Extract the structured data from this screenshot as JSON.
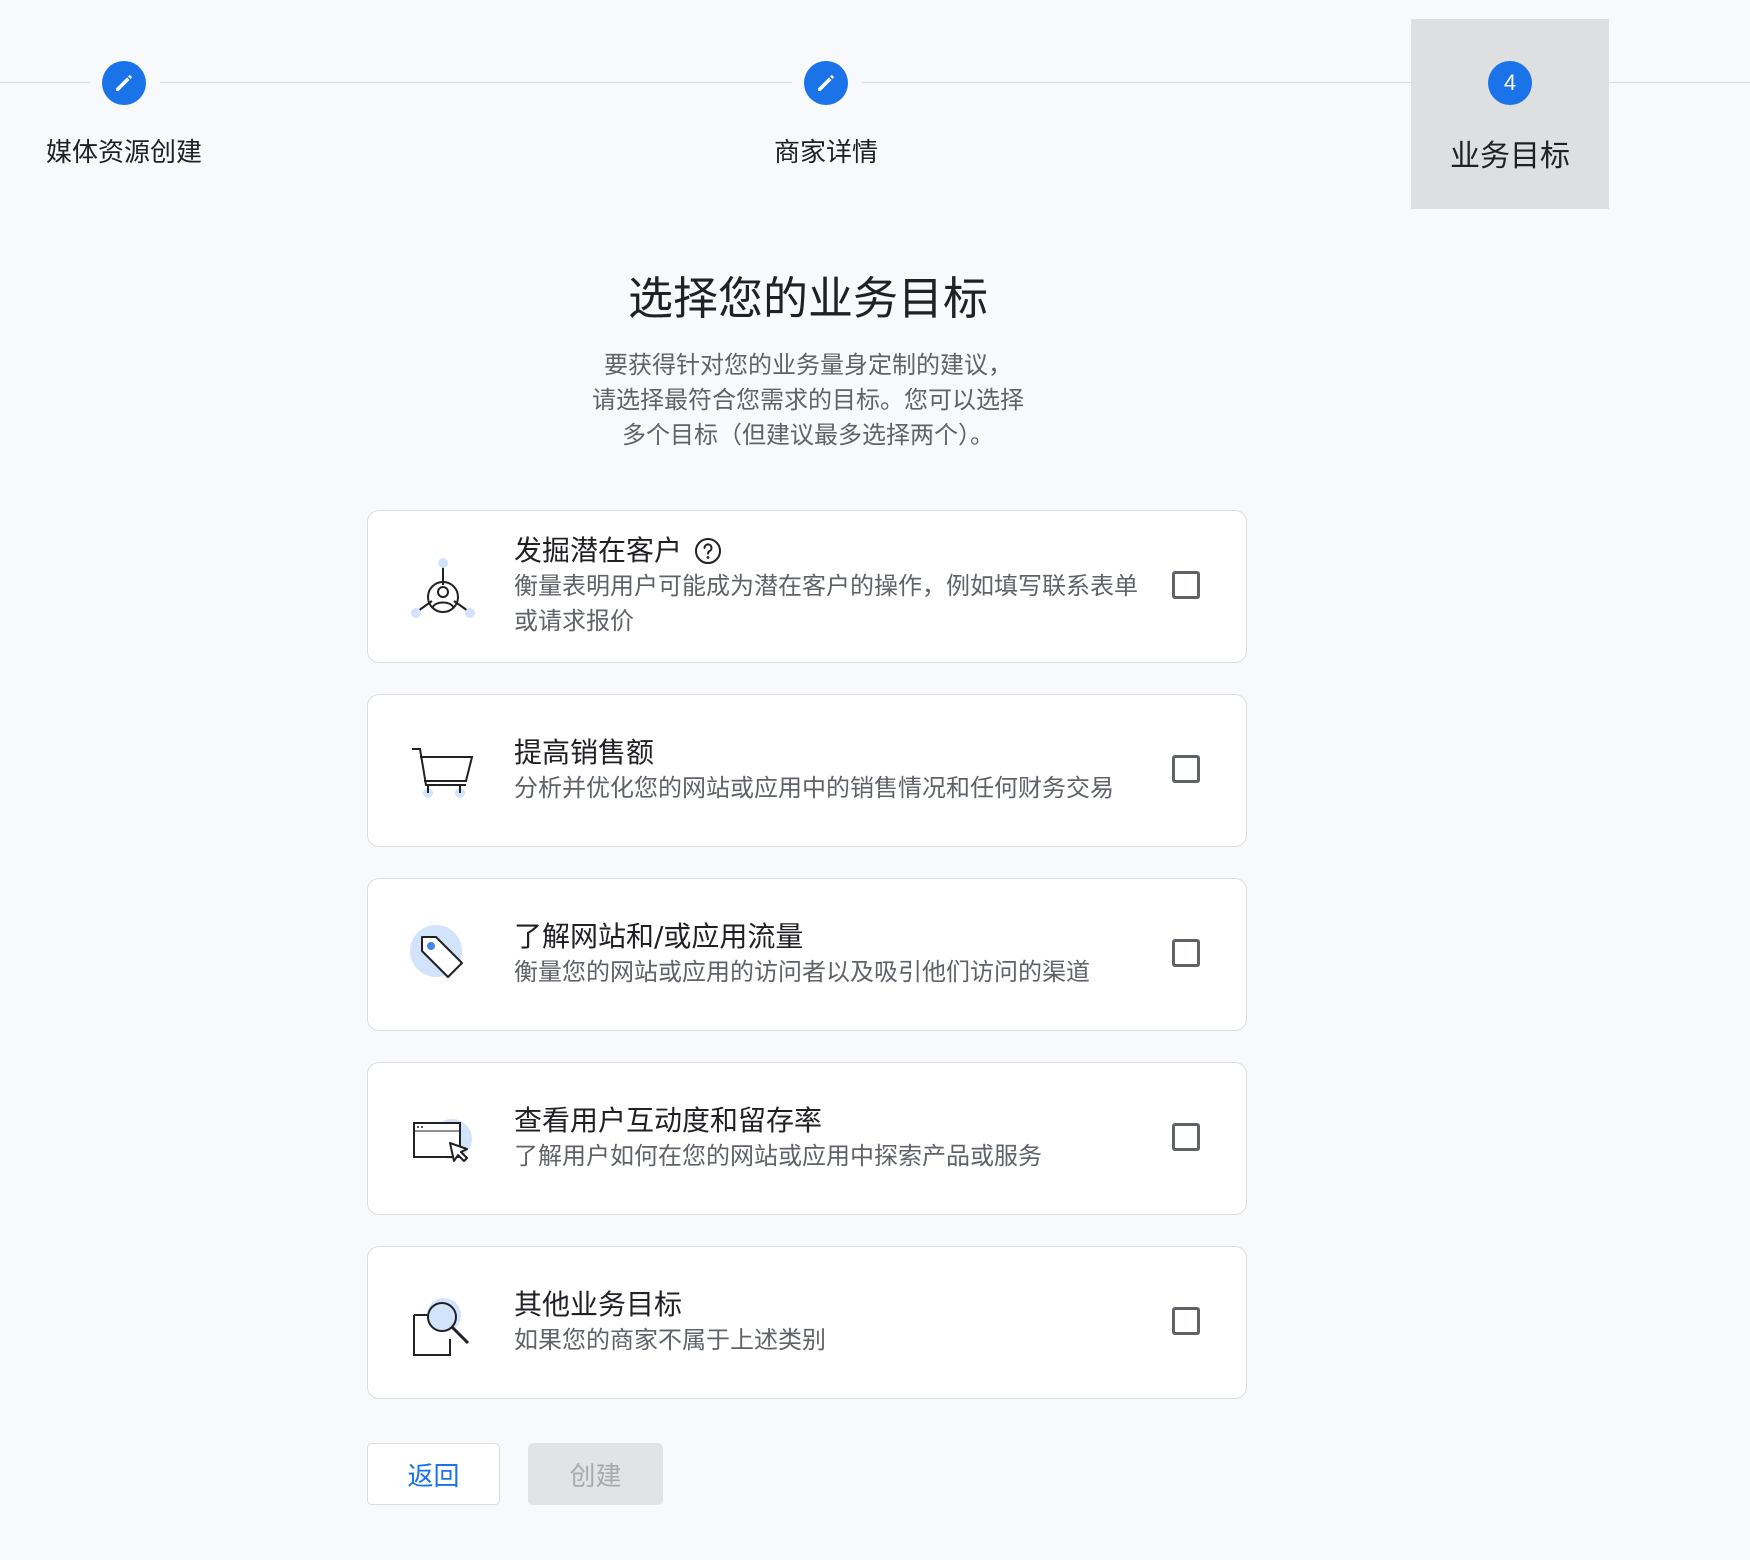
{
  "stepper": {
    "steps": [
      {
        "label": "媒体资源创建",
        "state": "done",
        "icon": "pencil-icon"
      },
      {
        "label": "商家详情",
        "state": "done",
        "icon": "pencil-icon"
      },
      {
        "label": "业务目标",
        "state": "active",
        "number": "4"
      }
    ]
  },
  "header": {
    "title": "选择您的业务目标",
    "description_lines": [
      "要获得针对您的业务量身定制的建议，",
      "请选择最符合您需求的目标。您可以选择",
      "多个目标（但建议最多选择两个）。"
    ]
  },
  "objectives": [
    {
      "title": "发掘潜在客户",
      "subtitle": "衡量表明用户可能成为潜在客户的操作，例如填写联系表单或请求报价",
      "icon": "lead-network-icon",
      "has_help": true,
      "checked": false
    },
    {
      "title": "提高销售额",
      "subtitle": "分析并优化您的网站或应用中的销售情况和任何财务交易",
      "icon": "shopping-cart-icon",
      "has_help": false,
      "checked": false
    },
    {
      "title": "了解网站和/或应用流量",
      "subtitle": "衡量您的网站或应用的访问者以及吸引他们访问的渠道",
      "icon": "tag-icon",
      "has_help": false,
      "checked": false
    },
    {
      "title": "查看用户互动度和留存率",
      "subtitle": "了解用户如何在您的网站或应用中探索产品或服务",
      "icon": "window-cursor-icon",
      "has_help": false,
      "checked": false
    },
    {
      "title": "其他业务目标",
      "subtitle": "如果您的商家不属于上述类别",
      "icon": "magnifier-document-icon",
      "has_help": false,
      "checked": false
    }
  ],
  "buttons": {
    "back_label": "返回",
    "create_label": "创建",
    "create_disabled": true
  },
  "colors": {
    "accent": "#1a73e8",
    "background": "#f8f9fa",
    "card_border": "#dadce0",
    "active_step_bg": "#dedfe1",
    "text_secondary": "#5f6368",
    "icon_highlight": "#d2e3fc"
  }
}
